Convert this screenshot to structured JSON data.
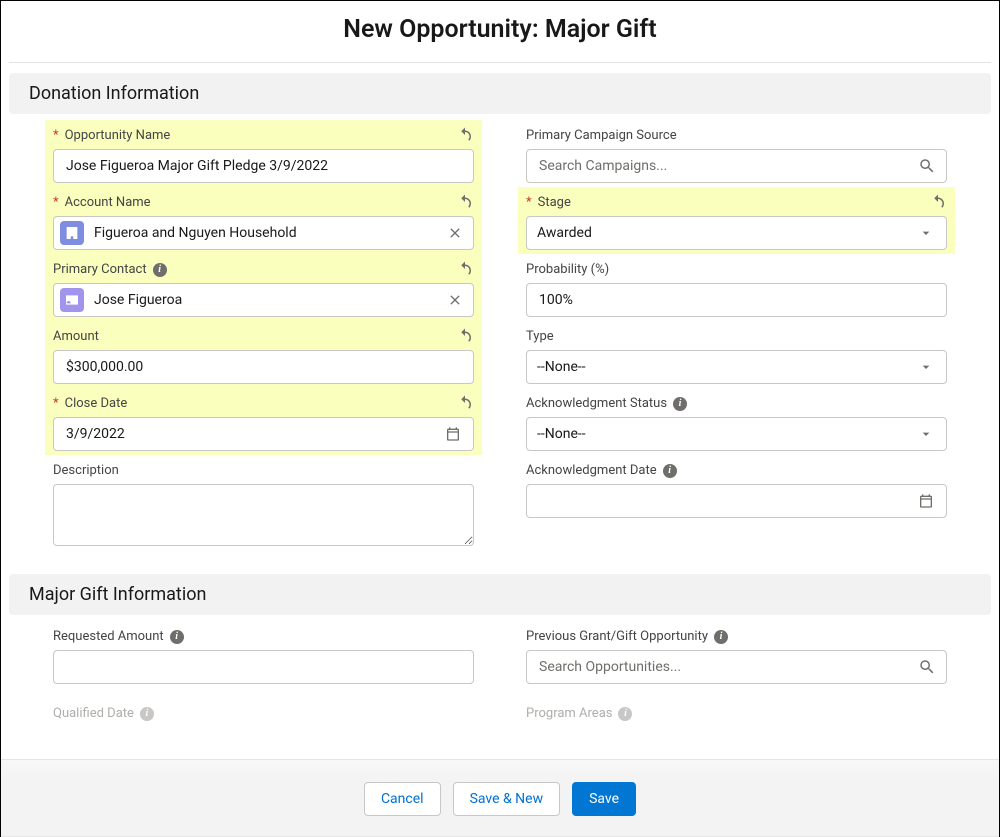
{
  "pageTitle": "New Opportunity: Major Gift",
  "sections": {
    "donation": {
      "title": "Donation Information"
    },
    "majorGift": {
      "title": "Major Gift Information"
    }
  },
  "fields": {
    "opportunityName": {
      "label": "Opportunity Name",
      "value": "Jose Figueroa Major Gift Pledge 3/9/2022"
    },
    "accountName": {
      "label": "Account Name",
      "value": "Figueroa and Nguyen Household"
    },
    "primaryContact": {
      "label": "Primary Contact",
      "value": "Jose Figueroa"
    },
    "amount": {
      "label": "Amount",
      "value": "$300,000.00"
    },
    "closeDate": {
      "label": "Close Date",
      "value": "3/9/2022"
    },
    "description": {
      "label": "Description",
      "value": ""
    },
    "primaryCampaign": {
      "label": "Primary Campaign Source",
      "placeholder": "Search Campaigns..."
    },
    "stage": {
      "label": "Stage",
      "value": "Awarded"
    },
    "probability": {
      "label": "Probability (%)",
      "value": "100%"
    },
    "type": {
      "label": "Type",
      "value": "--None--"
    },
    "ackStatus": {
      "label": "Acknowledgment Status",
      "value": "--None--"
    },
    "ackDate": {
      "label": "Acknowledgment Date",
      "value": ""
    },
    "requestedAmount": {
      "label": "Requested Amount",
      "value": ""
    },
    "previousGrant": {
      "label": "Previous Grant/Gift Opportunity",
      "placeholder": "Search Opportunities..."
    },
    "qualifiedDate": {
      "label": "Qualified Date"
    },
    "programAreas": {
      "label": "Program Areas"
    }
  },
  "buttons": {
    "cancel": "Cancel",
    "saveNew": "Save & New",
    "save": "Save"
  }
}
